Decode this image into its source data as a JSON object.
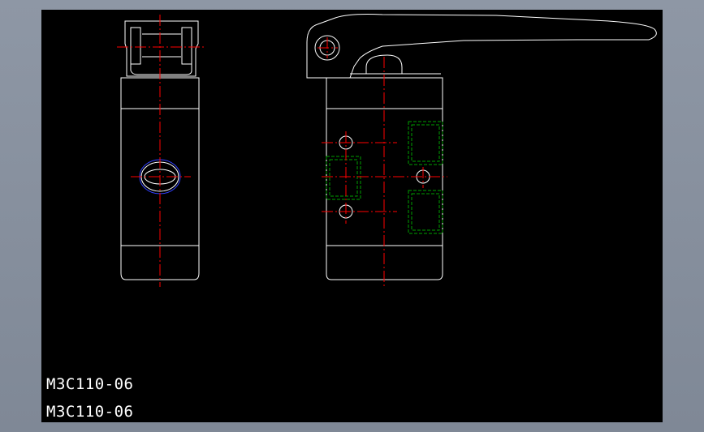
{
  "drawing": {
    "labels": [
      "M3C110-06",
      "M3C110-06"
    ]
  },
  "colors": {
    "outline": "#ffffff",
    "centerline": "#ff0000",
    "hidden": "#00a000",
    "circle": "#3040ff",
    "viewport_bg": "#000000",
    "frame_bg": "#8e97a5"
  }
}
